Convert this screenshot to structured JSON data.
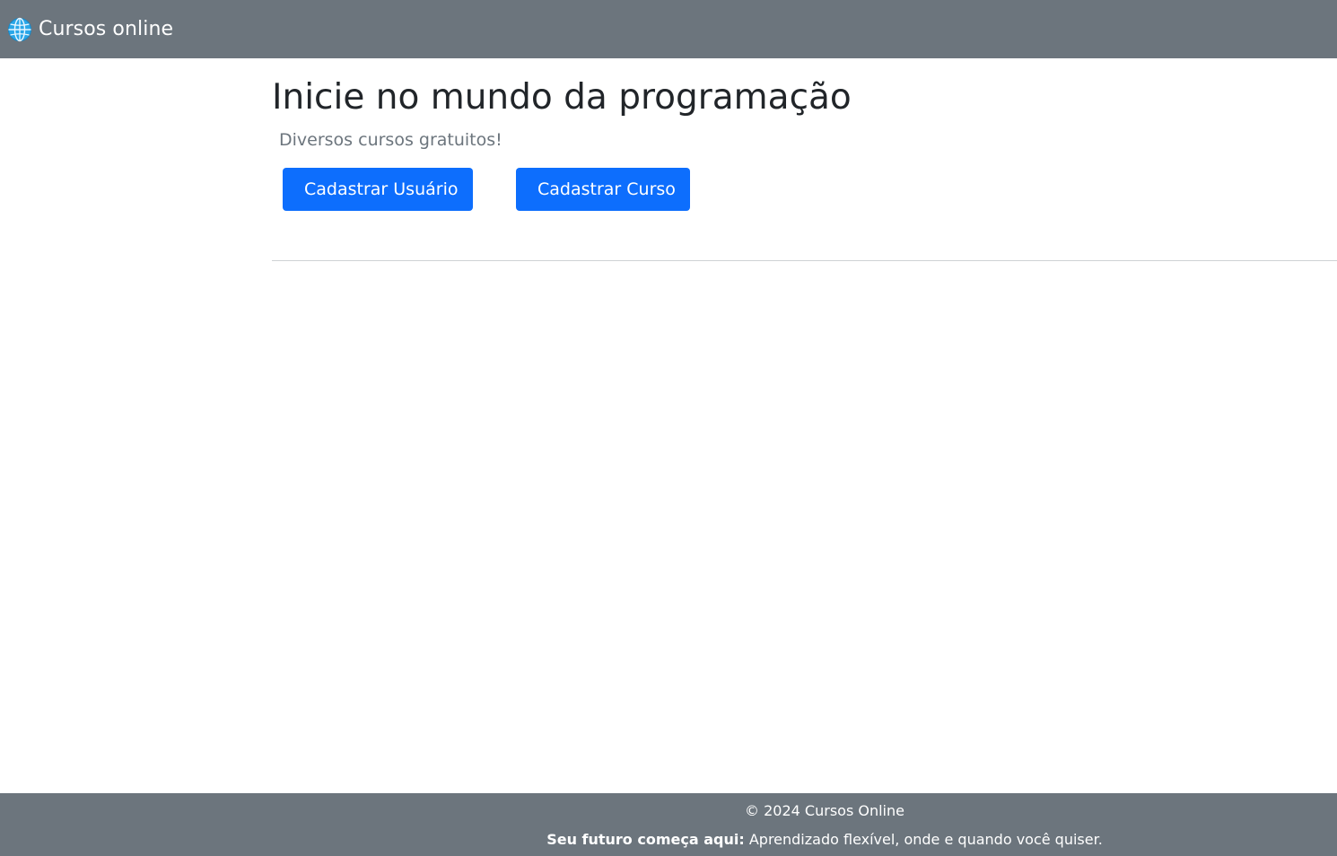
{
  "navbar": {
    "brand_icon": "globe-icon",
    "brand_label": "Cursos online"
  },
  "main": {
    "title": "Inicie no mundo da programação",
    "subtitle": "Diversos cursos gratuitos!",
    "buttons": [
      {
        "label": "Cadastrar Usuário"
      },
      {
        "label": "Cadastrar Curso"
      }
    ]
  },
  "footer": {
    "copyright": "© 2024 Cursos Online",
    "slogan_bold": "Seu futuro começa aqui:",
    "slogan_text": " Aprendizado flexível, onde e quando você quiser."
  },
  "colors": {
    "navbar_bg": "#6c757d",
    "primary": "#0d6efd",
    "title_text": "#212529",
    "muted_text": "#6c757d"
  }
}
